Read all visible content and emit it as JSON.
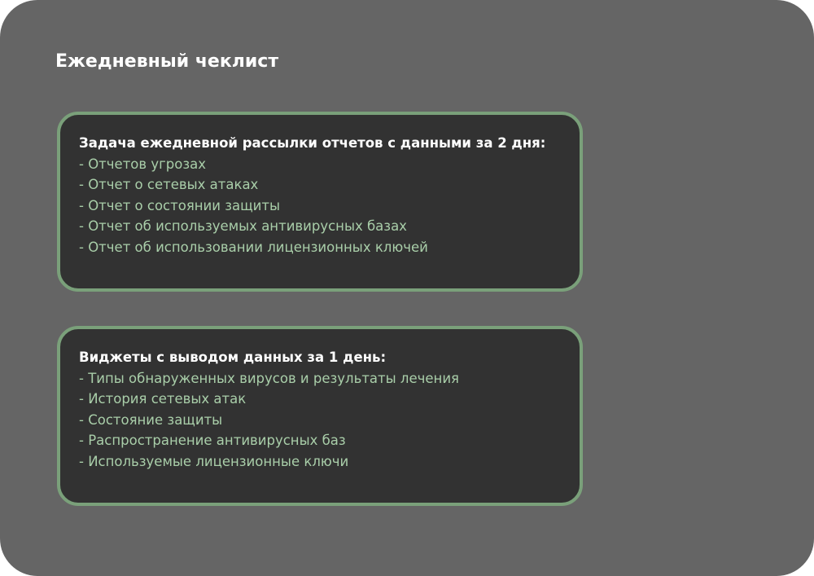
{
  "title": "Ежедневный чеклист",
  "cards": [
    {
      "heading": "Задача ежедневной рассылки отчетов с данными за 2 дня:",
      "items": [
        "- Отчетов угрозах",
        "- Отчет о сетевых атаках",
        "- Отчет о состоянии защиты",
        "- Отчет об используемых антивирусных базах",
        "- Отчет об использовании лицензионных ключей"
      ]
    },
    {
      "heading": "Виджеты с выводом данных за 1 день:",
      "items": [
        "- Типы обнаруженных вирусов и результаты лечения",
        "- История сетевых атак",
        "- Состояние защиты",
        "- Распространение антивирусных баз",
        "- Используемые лицензионные ключи"
      ]
    }
  ],
  "colors": {
    "background": "#656565",
    "card_background": "#323232",
    "card_border": "#7aa07a",
    "heading_text": "#ffffff",
    "item_text": "#a9cea9"
  }
}
